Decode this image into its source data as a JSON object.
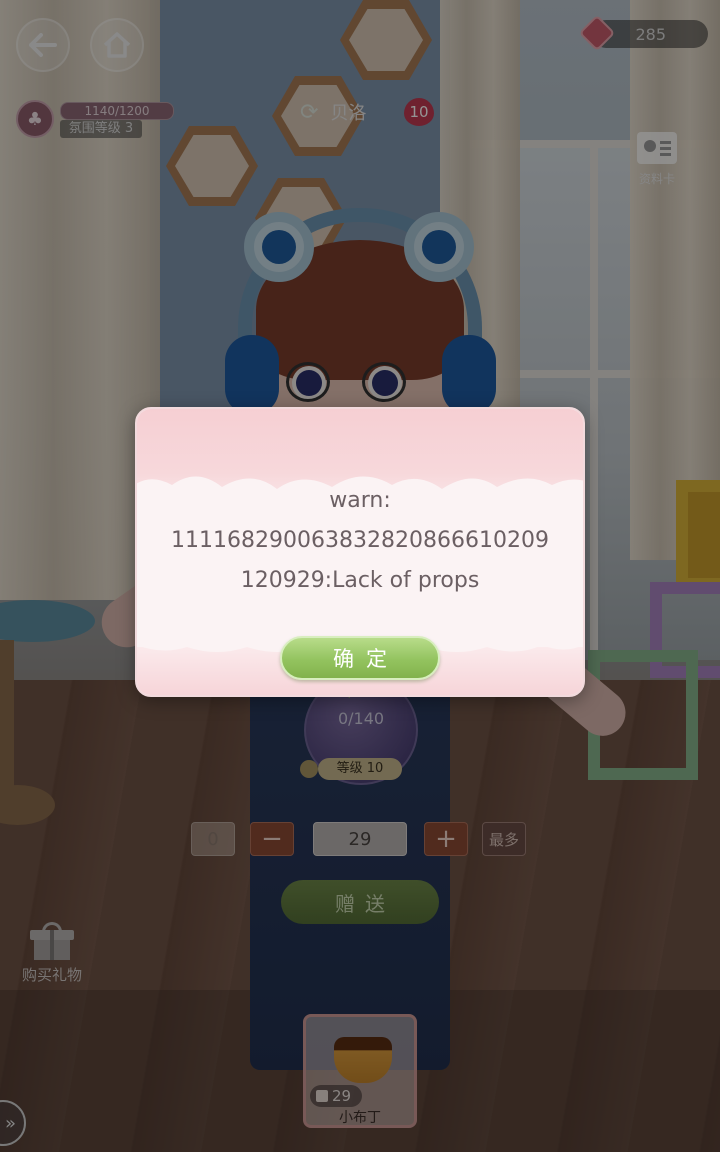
{
  "hud": {
    "back_icon": "arrow-left-icon",
    "home_icon": "home-icon",
    "currency_icon": "gem-icon",
    "currency_value": "285",
    "mood_icon": "tree-icon",
    "mood_progress": "1140/1200",
    "mood_level": "氛围等级 3",
    "partner_icon": "refresh-icon",
    "partner_name": "贝洛",
    "partner_badge": "10",
    "profile_label": "资料卡"
  },
  "gift_panel": {
    "progress_text": "0/140",
    "level_label": "等级 10",
    "qty_min": "0",
    "qty_minus": "−",
    "qty_value": "29",
    "qty_plus": "+",
    "qty_max": "最多",
    "send_label": "赠送",
    "buy_gift_label": "购买礼物",
    "item_count": "29",
    "item_name": "小布丁",
    "expand_icon": "chevron-right-icon"
  },
  "dialog": {
    "message_line1": "warn:",
    "message_line2": "1111682900638328208666102​09",
    "message_line3": "120929:Lack of props",
    "confirm_label": "确定"
  },
  "colors": {
    "dialog_bg": "#fbf3f4",
    "dialog_header": "#f6cfd3",
    "confirm_green": "#93c35f",
    "text_muted": "#6b5f63"
  }
}
